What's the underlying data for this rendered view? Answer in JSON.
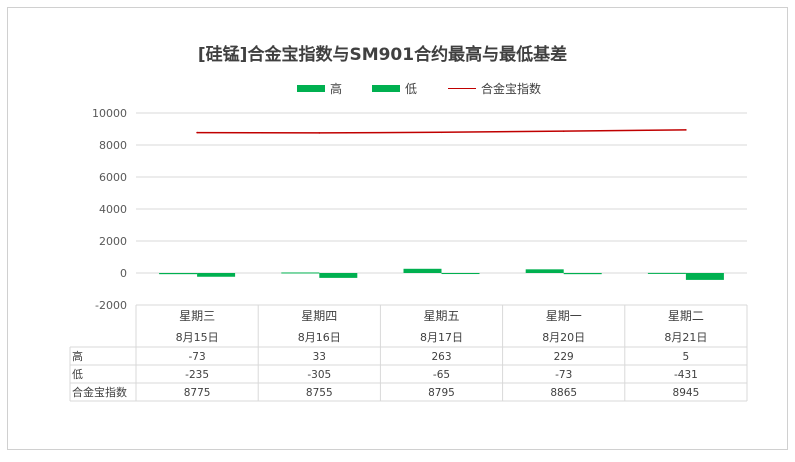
{
  "chart_data": {
    "type": "bar",
    "title": "[硅锰]合金宝指数与SM901合约最高与最低基差",
    "categories": [
      "星期三",
      "星期四",
      "星期五",
      "星期一",
      "星期二"
    ],
    "dates": [
      "8月15日",
      "8月16日",
      "8月17日",
      "8月20日",
      "8月21日"
    ],
    "series": [
      {
        "name": "高",
        "type": "bar",
        "color": "#00b050",
        "values": [
          -73,
          33,
          263,
          229,
          5
        ]
      },
      {
        "name": "低",
        "type": "bar",
        "color": "#00b050",
        "values": [
          -235,
          -305,
          -65,
          -73,
          -431
        ]
      },
      {
        "name": "合金宝指数",
        "type": "line",
        "color": "#c00000",
        "values": [
          8775,
          8755,
          8795,
          8865,
          8945
        ]
      }
    ],
    "ylim": [
      -2000,
      10000
    ],
    "yticks": [
      "10000",
      "8000",
      "6000",
      "4000",
      "2000",
      "0",
      "-2000"
    ],
    "grid": true,
    "legend": "top"
  }
}
